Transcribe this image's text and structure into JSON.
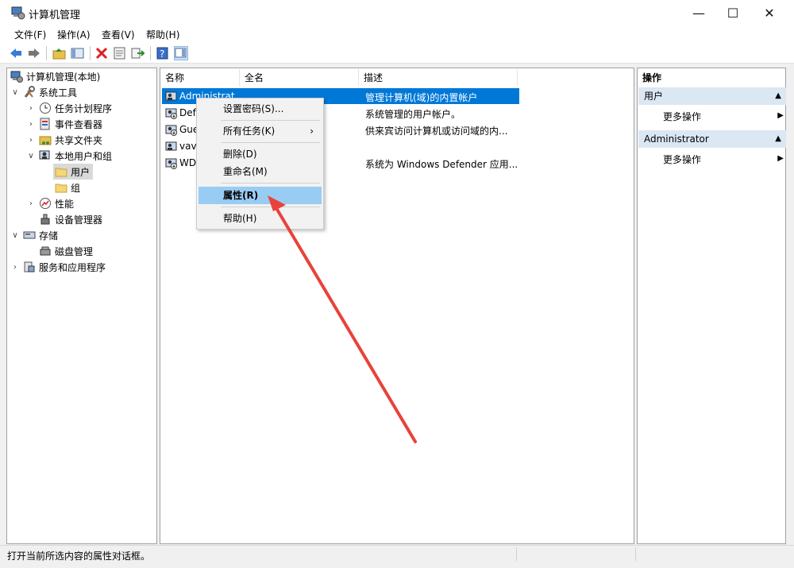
{
  "window": {
    "title": "计算机管理",
    "controls": {
      "minimize": "—",
      "maximize": "☐",
      "close": "✕"
    }
  },
  "menubar": [
    "文件(F)",
    "操作(A)",
    "查看(V)",
    "帮助(H)"
  ],
  "toolbar": {
    "icons": [
      "back-icon",
      "forward-icon",
      "up-folder-icon",
      "show-hide-tree-icon",
      "delete-icon",
      "properties-icon",
      "export-icon",
      "help-icon",
      "show-hide-action-pane-icon"
    ]
  },
  "tree": {
    "root": "计算机管理(本地)",
    "system_tools": "系统工具",
    "task_scheduler": "任务计划程序",
    "event_viewer": "事件查看器",
    "shared_folders": "共享文件夹",
    "local_users_groups": "本地用户和组",
    "users": "用户",
    "groups": "组",
    "performance": "性能",
    "device_manager": "设备管理器",
    "storage": "存储",
    "disk_management": "磁盘管理",
    "services_apps": "服务和应用程序"
  },
  "list": {
    "columns": [
      "名称",
      "全名",
      "描述"
    ],
    "rows": [
      {
        "name": "Administrat",
        "description": "管理计算机(域)的内置帐户"
      },
      {
        "name": "Def",
        "description": "系统管理的用户帐户。"
      },
      {
        "name": "Gue",
        "description": "供来宾访问计算机或访问域的内..."
      },
      {
        "name": "vava",
        "description": ""
      },
      {
        "name": "WD",
        "description": "系统为 Windows Defender 应用..."
      }
    ]
  },
  "context_menu": {
    "set_password": "设置密码(S)...",
    "all_tasks": "所有任务(K)",
    "all_tasks_arrow": "›",
    "delete": "删除(D)",
    "rename": "重命名(M)",
    "properties": "属性(R)",
    "help": "帮助(H)"
  },
  "actions": {
    "header": "操作",
    "section1": "用户",
    "section1_more": "更多操作",
    "section2": "Administrator",
    "section2_more": "更多操作",
    "collapse_glyph": "▲",
    "more_glyph": "▶"
  },
  "status": "打开当前所选内容的属性对话框。",
  "colors": {
    "selection": "#0078d7",
    "menu_highlight": "#99ccf3",
    "action_header": "#dbe7f3",
    "annotation_arrow": "#e8423a"
  }
}
